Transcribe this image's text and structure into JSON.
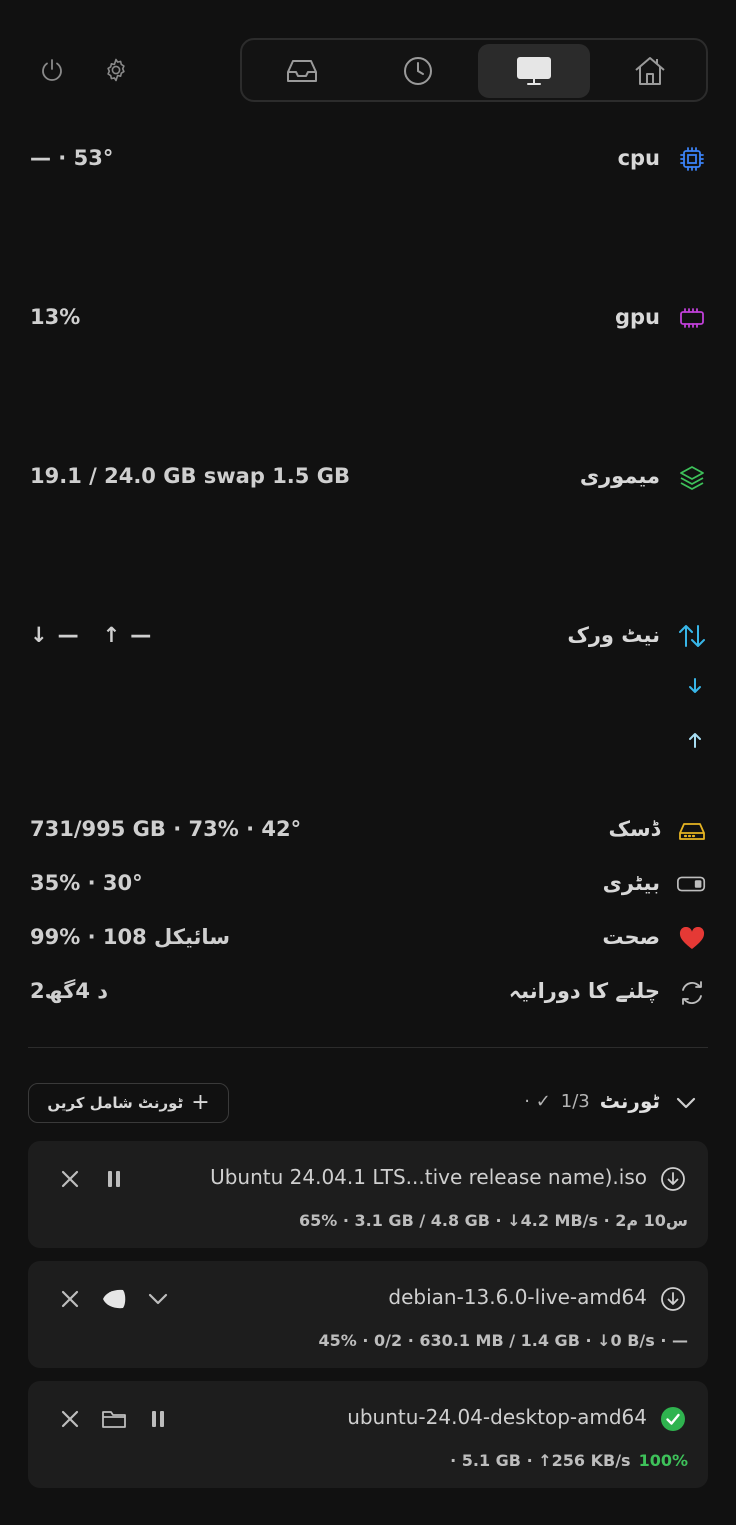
{
  "toolbar": {
    "tabs": [
      {
        "name": "inbox-tab",
        "icon": "inbox-icon",
        "active": false
      },
      {
        "name": "history-tab",
        "icon": "clock-icon",
        "active": false
      },
      {
        "name": "system-tab",
        "icon": "monitor-icon",
        "active": true
      },
      {
        "name": "home-tab",
        "icon": "home-icon",
        "active": false
      }
    ]
  },
  "metrics": {
    "cpu": {
      "label": "cpu",
      "value": "— · 53°",
      "color": "#3b82f6"
    },
    "gpu": {
      "label": "gpu",
      "value": "13%",
      "color": "#c040d8"
    },
    "memory": {
      "label": "میموری",
      "value": "19.1 / 24.0 GB  swap 1.5 GB",
      "color": "#3ec15a"
    },
    "network": {
      "label": "نیٹ ورک",
      "down": "—",
      "up": "—",
      "color": "#38b6e8"
    },
    "disk": {
      "label": "ڈسک",
      "value": "731/995 GB · 73% · 42°",
      "color": "#e6b422"
    },
    "battery": {
      "label": "بیٹری",
      "value": "35% · 30°"
    },
    "health": {
      "label": "صحت",
      "value": "99% · 108 سائیکل",
      "color": "#e53935"
    },
    "uptime": {
      "label": "چلنے کا دورانیہ",
      "value": "2د 4گھ"
    }
  },
  "torrents": {
    "title": "ٹورنٹ",
    "count": "1/3",
    "count_suffix": "✓ ·",
    "add_label": "ٹورنٹ شامل کریں",
    "items": [
      {
        "name": "Ubuntu 24.04.1 LTS...tive release name).iso",
        "meta": "65% · 3.1 GB / 4.8 GB · ↓4.2 MB/s · 2س10 م",
        "status": "downloading"
      },
      {
        "name": "debian-13.6.0-live-amd64",
        "meta": "45% · 0/2 · 630.1 MB / 1.4 GB · ↓0 B/s · —",
        "status": "downloading"
      },
      {
        "name": "ubuntu-24.04-desktop-amd64",
        "meta": "· 5.1 GB · ↑256 KB/s",
        "meta_percent": "100%",
        "status": "complete"
      }
    ]
  }
}
